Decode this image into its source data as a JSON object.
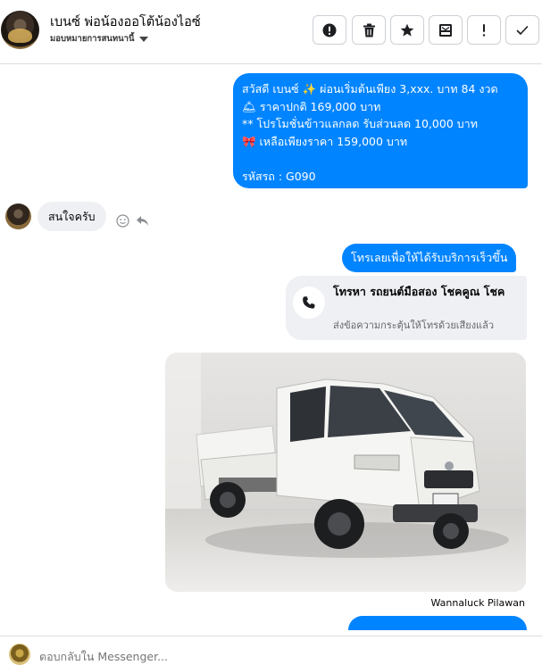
{
  "header": {
    "contact_name": "เบนซ์ พ่อน้องออโต้น้องไอซ์",
    "assign_label": "มอบหมายการสนทนานี้",
    "actions": [
      {
        "name": "report-spam-button",
        "icon": "alert-circle-icon",
        "glyph": "❗"
      },
      {
        "name": "delete-button",
        "icon": "trash-icon",
        "glyph": "🗑"
      },
      {
        "name": "star-button",
        "icon": "star-icon",
        "glyph": "★"
      },
      {
        "name": "archive-button",
        "icon": "archive-box-icon",
        "glyph": "🗄"
      },
      {
        "name": "follow-up-button",
        "icon": "exclamation-icon",
        "glyph": "!"
      },
      {
        "name": "mark-done-button",
        "icon": "check-icon",
        "glyph": "✓"
      }
    ]
  },
  "messages": {
    "main": {
      "line1": "สวัสดี เบนซ์ ✨  ผ่อนเริ่มต้นเพียง 3,xxx. บาท 84 งวด",
      "line2": "🛎 ราคาปกติ 169,000 บาท",
      "line3": "** โปรโมชั่นข้าวแลกลด รับส่วนลด 10,000 บาท",
      "line4": "🎀  เหลือเพียงราคา 159,000 บาท",
      "line5": "รหัสรถ : G090"
    },
    "reply": "สนใจครับ",
    "call_prompt": "โทรเลยเพื่อให้ได้รับบริการเร็วขึ้น",
    "call_card": {
      "title": "โทรหา รถยนต์มือสอง โชคคูณ โชค",
      "subtitle": "ส่งข้อความกระตุ้นให้โทรด้วยเสียงแล้ว"
    },
    "photo_caption": "Wannaluck Pilawan"
  },
  "footer": {
    "placeholder": "ตอบกลับใน Messenger..."
  },
  "colors": {
    "accent": "#0084ff",
    "incoming_bubble": "#eef0f3",
    "muted_text": "#65676b"
  }
}
